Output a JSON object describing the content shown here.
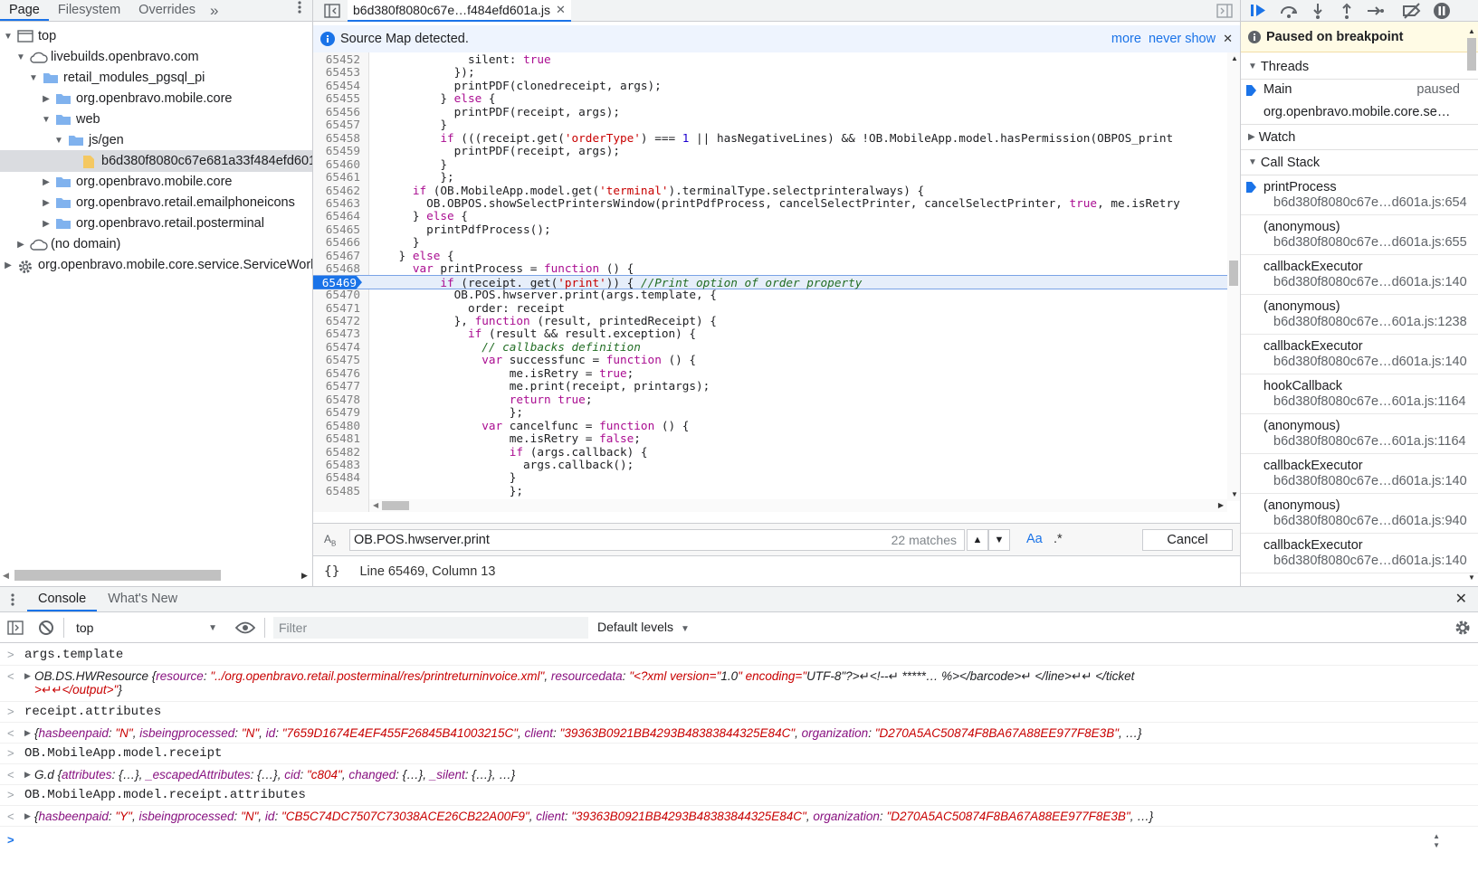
{
  "navigator": {
    "tabs": [
      "Page",
      "Filesystem",
      "Overrides"
    ],
    "more_tabs_glyph": "»",
    "tree": [
      {
        "label": "top",
        "icon": "frame-icon",
        "depth": 0,
        "arrow": "down"
      },
      {
        "label": "livebuilds.openbravo.com",
        "icon": "cloud-icon",
        "depth": 1,
        "arrow": "down"
      },
      {
        "label": "retail_modules_pgsql_pi",
        "icon": "folder-icon",
        "depth": 2,
        "arrow": "down"
      },
      {
        "label": "org.openbravo.mobile.core",
        "icon": "folder-icon",
        "depth": 3,
        "arrow": "right"
      },
      {
        "label": "web",
        "icon": "folder-icon",
        "depth": 3,
        "arrow": "down"
      },
      {
        "label": "js/gen",
        "icon": "folder-icon",
        "depth": 4,
        "arrow": "down"
      },
      {
        "label": "b6d380f8080c67e681a33f484efd601a.js",
        "icon": "file-icon",
        "depth": 5,
        "arrow": "none",
        "selected": true
      },
      {
        "label": "org.openbravo.mobile.core",
        "icon": "folder-icon",
        "depth": 3,
        "arrow": "right"
      },
      {
        "label": "org.openbravo.retail.emailphoneicons",
        "icon": "folder-icon",
        "depth": 3,
        "arrow": "right"
      },
      {
        "label": "org.openbravo.retail.posterminal",
        "icon": "folder-icon",
        "depth": 3,
        "arrow": "right"
      },
      {
        "label": "(no domain)",
        "icon": "cloud-icon",
        "depth": 1,
        "arrow": "right"
      },
      {
        "label": "org.openbravo.mobile.core.service.ServiceWorker",
        "icon": "gear-icon",
        "depth": 0,
        "arrow": "right"
      }
    ]
  },
  "editor": {
    "file_tab": "b6d380f8080c67e…f484efd601a.js",
    "infobar": {
      "message": "Source Map detected.",
      "more": "more",
      "never_show": "never show"
    },
    "search": {
      "query": "OB.POS.hwserver.print",
      "matches": "22 matches",
      "match_case": "Aa",
      "regex": ".*",
      "cancel": "Cancel"
    },
    "status": "Line 65469, Column 13",
    "format_glyph": "{}",
    "lines": [
      {
        "n": "65452",
        "code": "              silent: true"
      },
      {
        "n": "65453",
        "code": "            });"
      },
      {
        "n": "65454",
        "code": "            printPDF(clonedreceipt, args);"
      },
      {
        "n": "65455",
        "code": "          } else {"
      },
      {
        "n": "65456",
        "code": "            printPDF(receipt, args);"
      },
      {
        "n": "65457",
        "code": "          }"
      },
      {
        "n": "65458",
        "code": "          if (((receipt.get('orderType') === 1 || hasNegativeLines) && !OB.MobileApp.model.hasPermission('OBPOS_print"
      },
      {
        "n": "65459",
        "code": "            printPDF(receipt, args);"
      },
      {
        "n": "65460",
        "code": "          }"
      },
      {
        "n": "65461",
        "code": "          };"
      },
      {
        "n": "65462",
        "code": "      if (OB.MobileApp.model.get('terminal').terminalType.selectprinteralways) {"
      },
      {
        "n": "65463",
        "code": "        OB.OBPOS.showSelectPrintersWindow(printPdfProcess, cancelSelectPrinter, cancelSelectPrinter, true, me.isRetry"
      },
      {
        "n": "65464",
        "code": "      } else {"
      },
      {
        "n": "65465",
        "code": "        printPdfProcess();"
      },
      {
        "n": "65466",
        "code": "      }"
      },
      {
        "n": "65467",
        "code": "    } else {"
      },
      {
        "n": "65468",
        "code": "      var printProcess = function () {"
      },
      {
        "n": "65469",
        "code": "          if (receipt. get('print')) { //Print option of order property",
        "paused": true
      },
      {
        "n": "65470",
        "code": "            OB.POS.hwserver.print(args.template, {"
      },
      {
        "n": "65471",
        "code": "              order: receipt"
      },
      {
        "n": "65472",
        "code": "            }, function (result, printedReceipt) {"
      },
      {
        "n": "65473",
        "code": "              if (result && result.exception) {"
      },
      {
        "n": "65474",
        "code": "                // callbacks definition"
      },
      {
        "n": "65475",
        "code": "                var successfunc = function () {"
      },
      {
        "n": "65476",
        "code": "                    me.isRetry = true;"
      },
      {
        "n": "65477",
        "code": "                    me.print(receipt, printargs);"
      },
      {
        "n": "65478",
        "code": "                    return true;"
      },
      {
        "n": "65479",
        "code": "                    };"
      },
      {
        "n": "65480",
        "code": "                var cancelfunc = function () {"
      },
      {
        "n": "65481",
        "code": "                    me.isRetry = false;"
      },
      {
        "n": "65482",
        "code": "                    if (args.callback) {"
      },
      {
        "n": "65483",
        "code": "                      args.callback();"
      },
      {
        "n": "65484",
        "code": "                    }"
      },
      {
        "n": "65485",
        "code": "                    };"
      }
    ]
  },
  "debugger": {
    "status": "Paused on breakpoint",
    "threads_label": "Threads",
    "threads": [
      {
        "name": "Main",
        "state": "paused"
      },
      {
        "name": "org.openbravo.mobile.core.se…",
        "state": ""
      }
    ],
    "watch_label": "Watch",
    "callstack_label": "Call Stack",
    "frames": [
      {
        "fn": "printProcess",
        "loc": "b6d380f8080c67e…d601a.js:654",
        "current": true
      },
      {
        "fn": "(anonymous)",
        "loc": "b6d380f8080c67e…d601a.js:655"
      },
      {
        "fn": "callbackExecutor",
        "loc": "b6d380f8080c67e…d601a.js:140"
      },
      {
        "fn": "(anonymous)",
        "loc": "b6d380f8080c67e…601a.js:1238"
      },
      {
        "fn": "callbackExecutor",
        "loc": "b6d380f8080c67e…d601a.js:140"
      },
      {
        "fn": "hookCallback",
        "loc": "b6d380f8080c67e…601a.js:1164"
      },
      {
        "fn": "(anonymous)",
        "loc": "b6d380f8080c67e…601a.js:1164"
      },
      {
        "fn": "callbackExecutor",
        "loc": "b6d380f8080c67e…d601a.js:140"
      },
      {
        "fn": "(anonymous)",
        "loc": "b6d380f8080c67e…d601a.js:940"
      },
      {
        "fn": "callbackExecutor",
        "loc": "b6d380f8080c67e…d601a.js:140"
      }
    ]
  },
  "console": {
    "tabs": [
      "Console",
      "What's New"
    ],
    "context": "top",
    "filter_placeholder": "Filter",
    "levels": "Default levels",
    "messages": [
      {
        "kind": "input",
        "text": "args.template"
      },
      {
        "kind": "output",
        "text": "OB.DS.HWResource {resource: \"../org.openbravo.retail.posterminal/res/printreturninvoice.xml\", resourcedata: \"<?xml version=\"1.0\" encoding=\"UTF-8\"?>↵<!--↵ *****… %></barcode>↵    </line>↵↵  </ticket",
        "text2": ">↵↵</output>\"}"
      },
      {
        "kind": "input",
        "text": "receipt.attributes"
      },
      {
        "kind": "output",
        "text": "{hasbeenpaid: \"N\", isbeingprocessed: \"N\", id: \"7659D1674E4EF455F26845B41003215C\", client: \"39363B0921BB4293B48383844325E84C\", organization: \"D270A5AC50874F8BA67A88EE977F8E3B\", …}"
      },
      {
        "kind": "input",
        "text": "OB.MobileApp.model.receipt"
      },
      {
        "kind": "output",
        "text": "G.d {attributes: {…}, _escapedAttributes: {…}, cid: \"c804\", changed: {…}, _silent: {…}, …}"
      },
      {
        "kind": "input",
        "text": "OB.MobileApp.model.receipt.attributes"
      },
      {
        "kind": "output",
        "text": "{hasbeenpaid: \"Y\", isbeingprocessed: \"N\", id: \"CB5C74DC7507C73038ACE26CB22A00F9\", client: \"39363B0921BB4293B48383844325E84C\", organization: \"D270A5AC50874F8BA67A88EE977F8E3B\", …}"
      }
    ]
  },
  "colors": {
    "accent": "#1a73e8",
    "paused_bg": "#fffbe5",
    "paused_line": "#e6eefa",
    "string": "#c80000",
    "keyword": "#aa0d91"
  }
}
